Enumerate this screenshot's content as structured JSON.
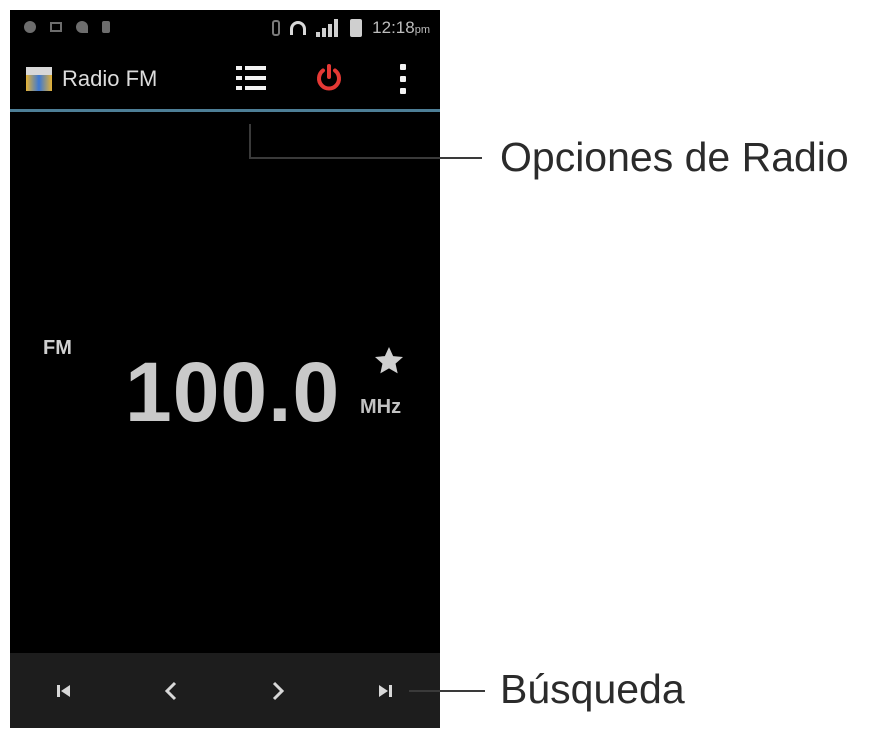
{
  "status_bar": {
    "time": "12:18",
    "time_suffix": "pm",
    "icons": [
      "notification-icon",
      "message-icon",
      "wifi-icon",
      "usb-icon",
      "bluetooth-icon",
      "headset-icon",
      "signal-icon",
      "battery-icon"
    ]
  },
  "action_bar": {
    "app_title": "Radio FM",
    "app_icon": "radio-app-icon",
    "actions": [
      "station-list-icon",
      "power-icon",
      "overflow-menu-icon"
    ],
    "power_color": "#e53935",
    "divider_color": "#4d7e96"
  },
  "tuner": {
    "band": "FM",
    "frequency": "100.0",
    "unit": "MHz",
    "favorite_icon": "star-icon"
  },
  "bottom_controls": [
    "skip-previous-icon",
    "tune-down-icon",
    "tune-up-icon",
    "skip-next-icon"
  ],
  "callouts": {
    "radio_options": "Opciones de Radio",
    "search": "Búsqueda"
  }
}
